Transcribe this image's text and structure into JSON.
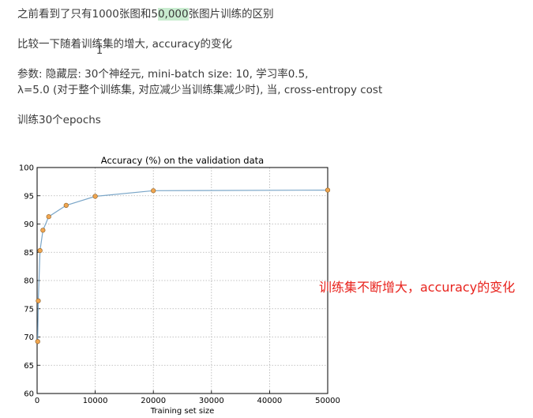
{
  "notes": {
    "line1_prefix": "之前看到了只有1000张图和5",
    "line1_highlight": "0,000",
    "line1_suffix": "张图片训练的区别",
    "line2": "比较一下随着训练集的增大, accuracy的变化",
    "line3": "参数: 隐藏层: 30个神经元, mini-batch size: 10, 学习率0.5,",
    "line4": "λ=5.0 (对于整个训练集, 对应减少当训练集减少时), 当, cross-entropy cost",
    "line5": "训练30个epochs",
    "cursor_glyph": "I"
  },
  "annotation": {
    "text": "训练集不断增大，accuracy的变化",
    "color": "#e8231d"
  },
  "chart_data": {
    "type": "line",
    "title": "Accuracy (%) on the validation data",
    "xlabel": "Training set size",
    "ylabel": "",
    "xlim": [
      0,
      50000
    ],
    "ylim": [
      60,
      100
    ],
    "x_ticks": [
      0,
      10000,
      20000,
      30000,
      40000,
      50000
    ],
    "y_ticks": [
      60,
      65,
      70,
      75,
      80,
      85,
      90,
      95,
      100
    ],
    "grid": true,
    "series": [
      {
        "x": [
          100,
          200,
          500,
          1000,
          2000,
          5000,
          10000,
          20000,
          50000
        ],
        "y": [
          69.2,
          76.4,
          85.3,
          88.9,
          91.3,
          93.3,
          94.9,
          95.9,
          96.0
        ],
        "line_color": "#7aa6c8",
        "marker_color": "#f0a650"
      }
    ]
  }
}
